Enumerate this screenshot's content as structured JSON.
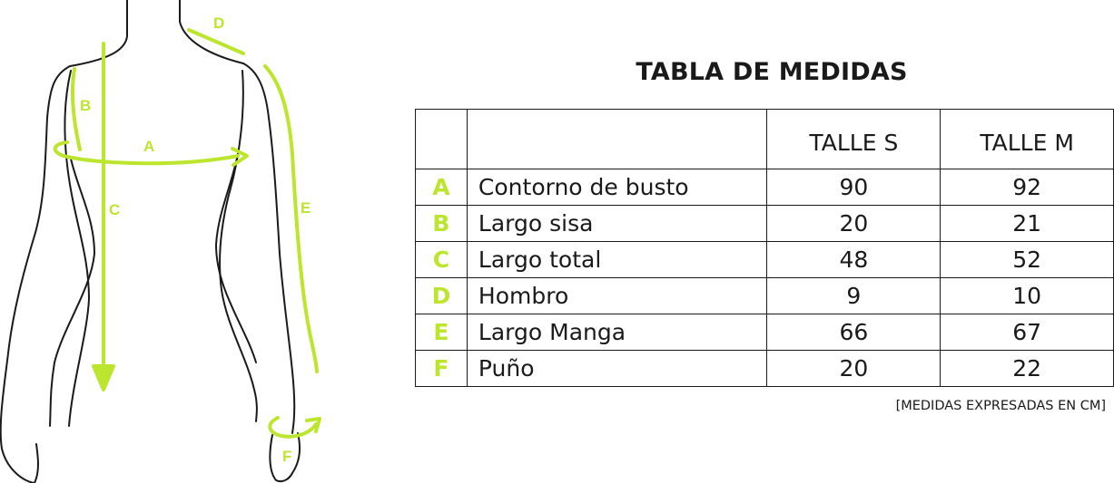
{
  "title": "TABLA DE MEDIDAS",
  "headers": [
    "",
    "",
    "TALLE S",
    "TALLE M"
  ],
  "rows": [
    {
      "letter": "A",
      "name": "Contorno de busto",
      "s": "90",
      "m": "92"
    },
    {
      "letter": "B",
      "name": "Largo sisa",
      "s": "20",
      "m": "21"
    },
    {
      "letter": "C",
      "name": "Largo total",
      "s": "48",
      "m": "52"
    },
    {
      "letter": "D",
      "name": "Hombro",
      "s": "9",
      "m": "10"
    },
    {
      "letter": "E",
      "name": "Largo Manga",
      "s": "66",
      "m": "67"
    },
    {
      "letter": "F",
      "name": "Puño",
      "s": "20",
      "m": "22"
    }
  ],
  "note": "[MEDIDAS EXPRESADAS EN CM]",
  "figure_labels": {
    "a": "A",
    "b": "B",
    "c": "C",
    "d": "D",
    "e": "E",
    "f": "F"
  },
  "colors": {
    "accent": "#bce62e",
    "ink": "#1a1a1a"
  }
}
